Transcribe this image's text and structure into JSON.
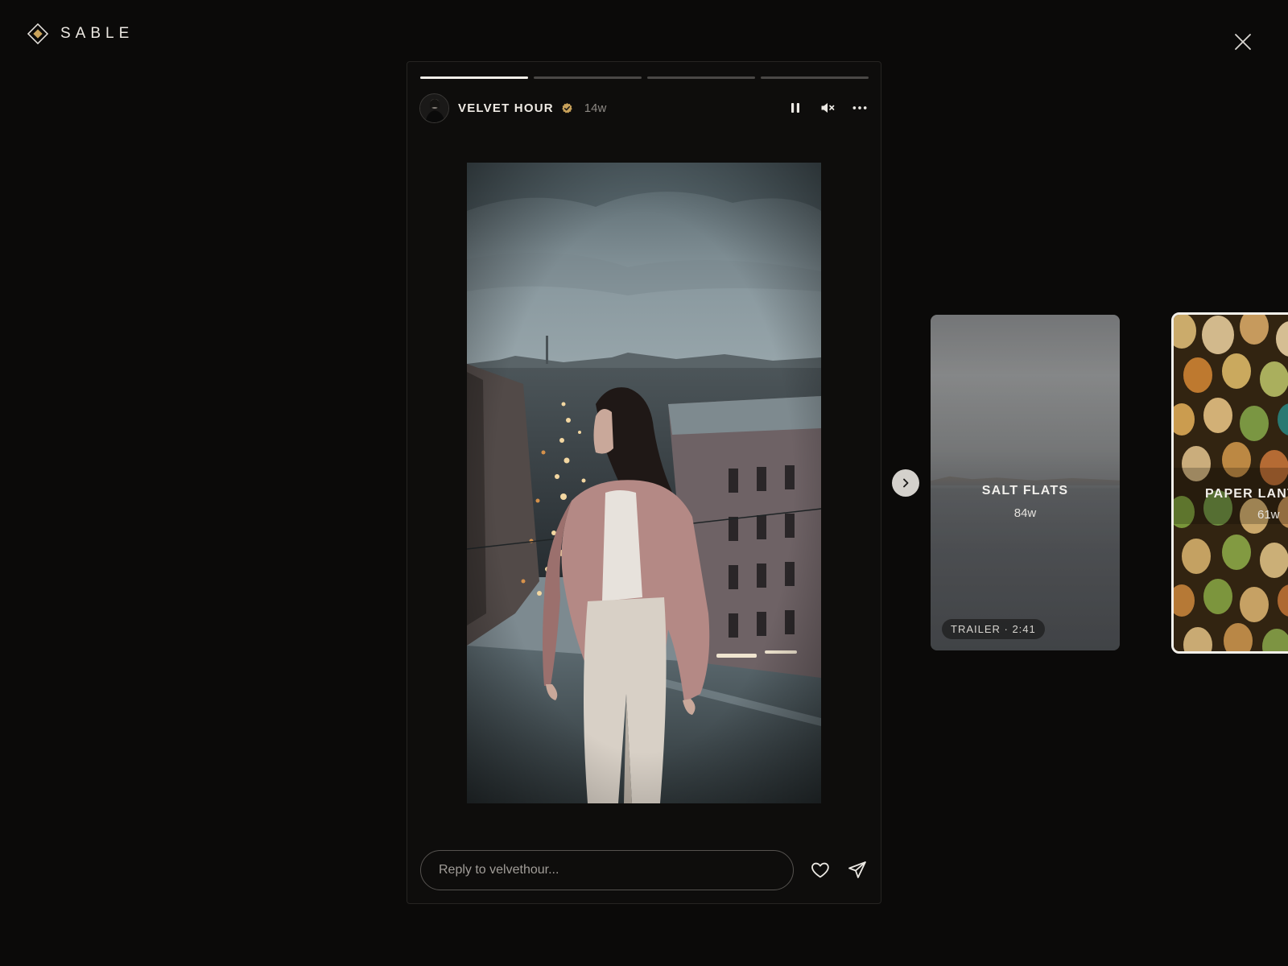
{
  "brand": {
    "name": "SABLE"
  },
  "story": {
    "progress": [
      1,
      0,
      0,
      0
    ],
    "author": "VELVET HOUR",
    "age": "14w",
    "reply_placeholder": "Reply to velvethour..."
  },
  "cards": [
    {
      "title": "SALT FLATS",
      "age": "84w",
      "badge": "TRAILER · 2:41"
    },
    {
      "title": "PAPER LANT",
      "age": "61w"
    }
  ],
  "icons": {
    "brand": "diamond-logo-icon",
    "close": "close-icon",
    "verified": "verified-badge-icon",
    "pause": "pause-icon",
    "mute": "mute-icon",
    "more": "more-horizontal-icon",
    "like": "heart-icon",
    "send": "send-icon",
    "next": "chevron-right-icon"
  },
  "colors": {
    "accent": "#c9a25a",
    "background": "#0b0a09"
  }
}
